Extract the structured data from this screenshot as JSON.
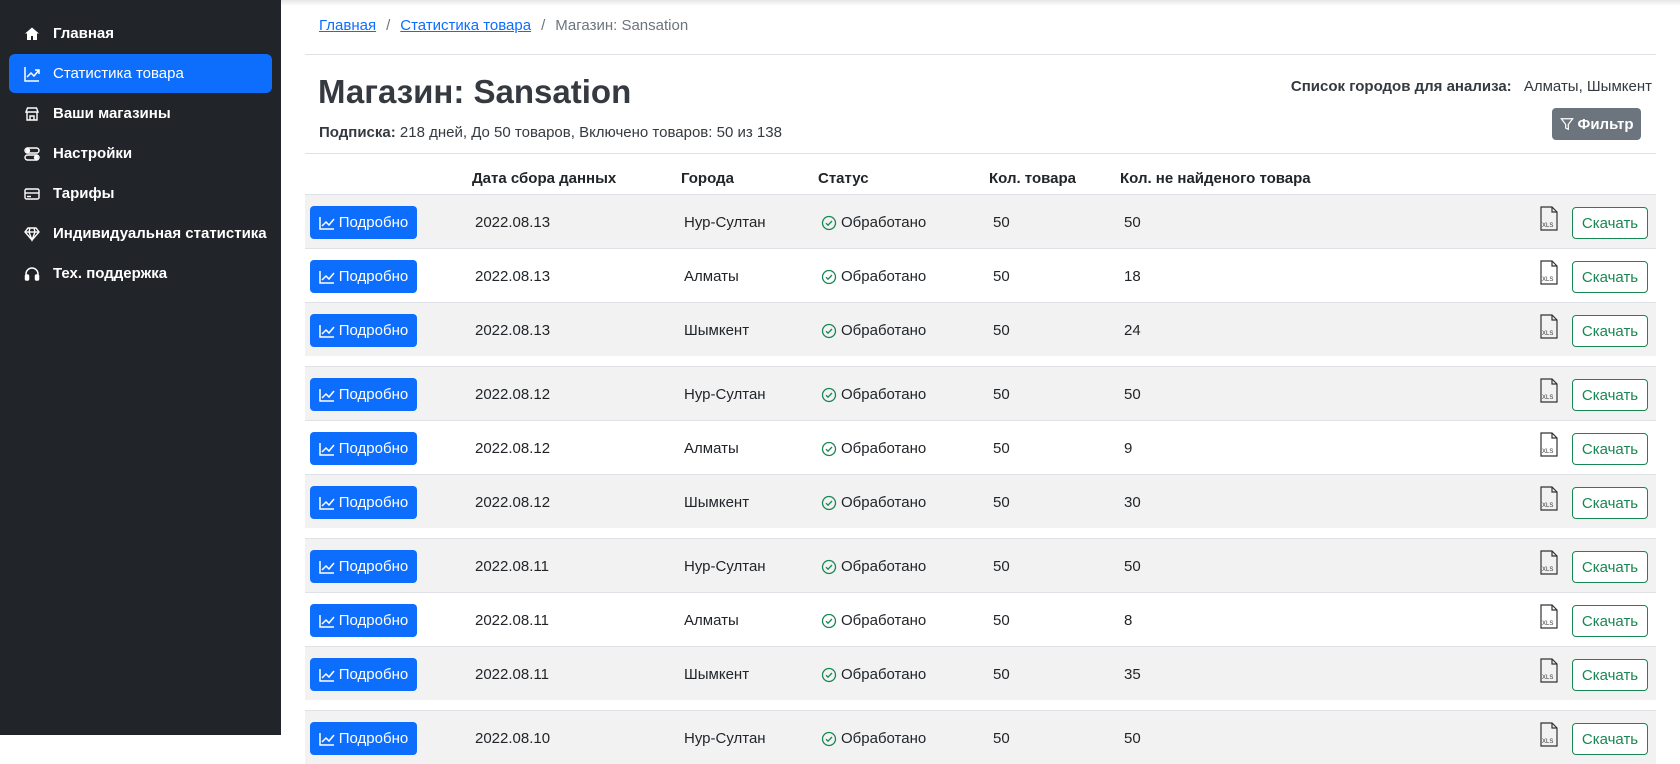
{
  "sidebar": {
    "items": [
      {
        "label": "Главная",
        "icon": "home-icon",
        "active": false
      },
      {
        "label": "Статистика товара",
        "icon": "chart-line-icon",
        "active": true
      },
      {
        "label": "Ваши магазины",
        "icon": "shop-icon",
        "active": false
      },
      {
        "label": "Настройки",
        "icon": "toggles-icon",
        "active": false
      },
      {
        "label": "Тарифы",
        "icon": "credit-card-icon",
        "active": false
      },
      {
        "label": "Индивидуальная статистика",
        "icon": "gem-icon",
        "active": false
      },
      {
        "label": "Тех. поддержка",
        "icon": "headset-icon",
        "active": false
      }
    ]
  },
  "breadcrumb": {
    "home": "Главная",
    "stats": "Статистика товара",
    "current": "Магазин: Sansation",
    "sep": "/"
  },
  "page": {
    "title": "Магазин: Sansation",
    "subscription_label": "Подписка:",
    "subscription_text": "218 дней, До 50 товаров, Включено товаров: 50 из 138",
    "cities_label": "Список городов для анализа:",
    "cities_value": "Алматы, Шымкент",
    "filter_label": "Фильтр"
  },
  "table": {
    "headers": {
      "date": "Дата сбора данных",
      "city": "Города",
      "status": "Статус",
      "count": "Кол. товара",
      "notfound": "Кол. не найденого товара"
    },
    "detail_label": "Подробно",
    "download_label": "Скачать",
    "rows": [
      {
        "date": "2022.08.13",
        "city": "Нур-Султан",
        "status": "Обработано",
        "count": "50",
        "notfound": "50"
      },
      {
        "date": "2022.08.13",
        "city": "Алматы",
        "status": "Обработано",
        "count": "50",
        "notfound": "18"
      },
      {
        "date": "2022.08.13",
        "city": "Шымкент",
        "status": "Обработано",
        "count": "50",
        "notfound": "24"
      },
      {
        "date": "2022.08.12",
        "city": "Нур-Султан",
        "status": "Обработано",
        "count": "50",
        "notfound": "50"
      },
      {
        "date": "2022.08.12",
        "city": "Алматы",
        "status": "Обработано",
        "count": "50",
        "notfound": "9"
      },
      {
        "date": "2022.08.12",
        "city": "Шымкент",
        "status": "Обработано",
        "count": "50",
        "notfound": "30"
      },
      {
        "date": "2022.08.11",
        "city": "Нур-Султан",
        "status": "Обработано",
        "count": "50",
        "notfound": "50"
      },
      {
        "date": "2022.08.11",
        "city": "Алматы",
        "status": "Обработано",
        "count": "50",
        "notfound": "8"
      },
      {
        "date": "2022.08.11",
        "city": "Шымкент",
        "status": "Обработано",
        "count": "50",
        "notfound": "35"
      },
      {
        "date": "2022.08.10",
        "city": "Нур-Султан",
        "status": "Обработано",
        "count": "50",
        "notfound": "50"
      }
    ]
  },
  "colors": {
    "sidebar_bg": "#212529",
    "primary": "#0d6efd",
    "success": "#198754",
    "secondary": "#6c757d"
  }
}
